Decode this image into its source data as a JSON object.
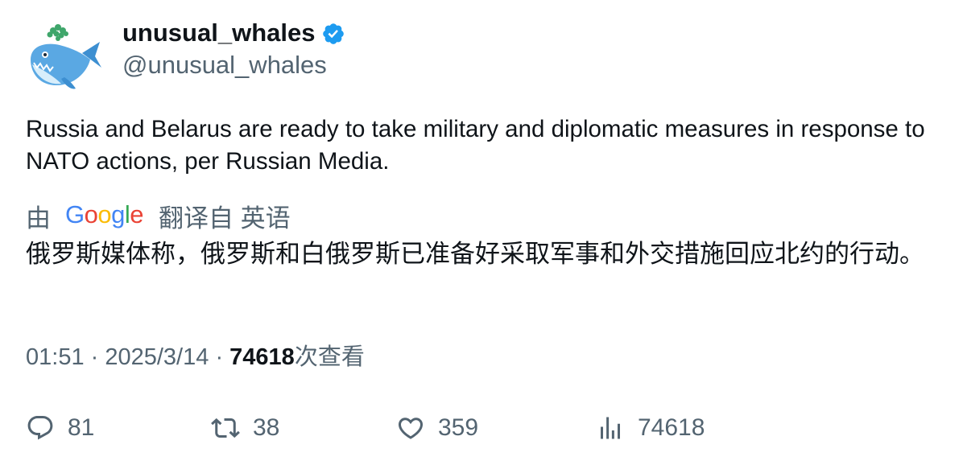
{
  "author": {
    "display_name": "unusual_whales",
    "handle": "@unusual_whales",
    "verified": true,
    "verified_color": "#1d9bf0"
  },
  "tweet": {
    "text": "Russia and Belarus are ready to take military and diplomatic measures in response to NATO actions, per Russian Media."
  },
  "translation": {
    "by_label": "由",
    "provider": "Google",
    "from_label": "翻译自 英语",
    "text": "俄罗斯媒体称，俄罗斯和白俄罗斯已准备好采取军事和外交措施回应北约的行动。"
  },
  "meta": {
    "time": "01:51",
    "separator": "·",
    "date": "2025/3/14",
    "views_count": "74618",
    "views_label": "次查看"
  },
  "actions": {
    "replies": "81",
    "retweets": "38",
    "likes": "359",
    "views": "74618"
  },
  "icons": {
    "avatar": "whale-avatar-icon",
    "verified": "verified-badge-icon",
    "reply": "reply-icon",
    "retweet": "retweet-icon",
    "like": "heart-icon",
    "views": "analytics-icon"
  },
  "colors": {
    "text_primary": "#0f1419",
    "text_secondary": "#536471",
    "accent": "#1d9bf0"
  }
}
